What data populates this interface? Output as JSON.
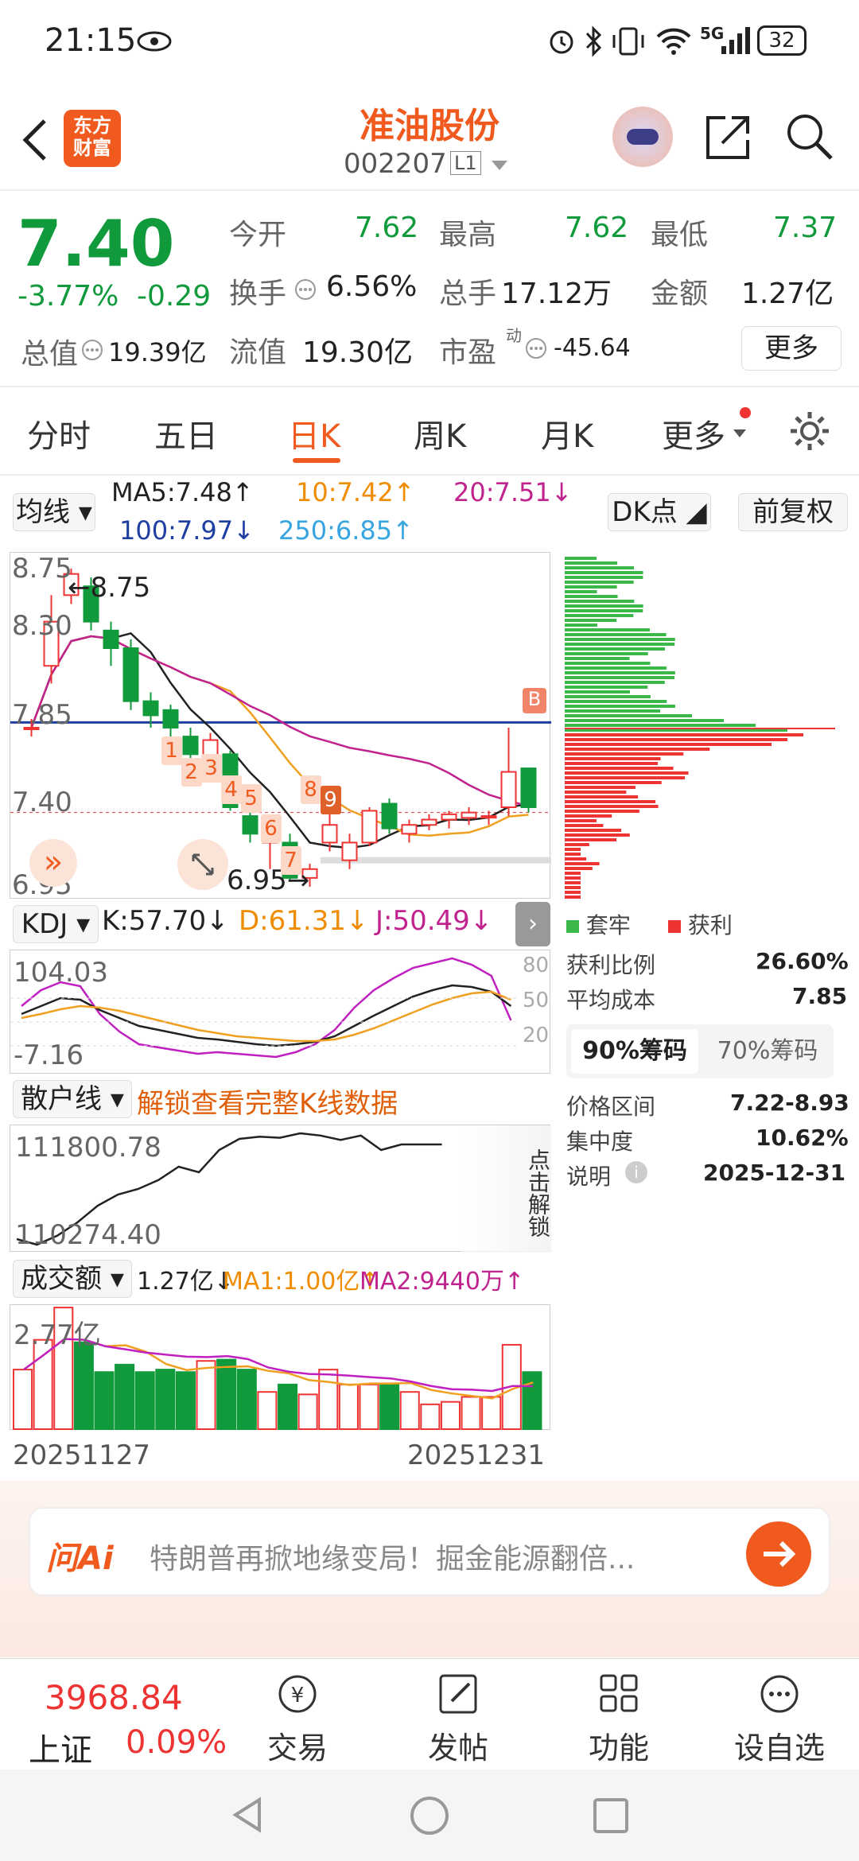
{
  "status": {
    "time": "21:15",
    "battery": "32",
    "network": "5G"
  },
  "header": {
    "name": "准油股份",
    "code": "002207",
    "badge": "L1",
    "logo": "东方\n财富",
    "logo_l1": "东方",
    "logo_l2": "财富"
  },
  "quote": {
    "price": "7.40",
    "pct": "-3.77%",
    "chg": "-0.29",
    "open_label": "今开",
    "open": "7.62",
    "high_label": "最高",
    "high": "7.62",
    "low_label": "最低",
    "low": "7.37",
    "turnover_label": "换手",
    "turnover": "6.56%",
    "vol_label": "总手",
    "vol": "17.12万",
    "amt_label": "金额",
    "amt": "1.27亿",
    "mcap_label": "总值",
    "mcap": "19.39亿",
    "float_label": "流值",
    "float": "19.30亿",
    "pe_label": "市盈",
    "pe_sup": "动",
    "pe": "-45.64",
    "more": "更多"
  },
  "tabs": [
    "分时",
    "五日",
    "日K",
    "周K",
    "月K",
    "更多"
  ],
  "ma": {
    "label": "均线",
    "ma5": "MA5:7.48↑",
    "ma10": "10:7.42↑",
    "ma20": "20:7.51↓",
    "ma100": "100:7.97↓",
    "ma250": "250:6.85↑",
    "dk": "DK点",
    "fq": "前复权"
  },
  "kline": {
    "y_labels": [
      "8.75",
      "8.30",
      "7.85",
      "7.40",
      "6.95"
    ],
    "high_marker": "8.75",
    "low_marker": "6.95",
    "b_marker": "B",
    "seq": [
      "1",
      "2",
      "3",
      "4",
      "5",
      "6",
      "7",
      "8",
      "9"
    ]
  },
  "chips": {
    "legend_trapped": "套牢",
    "legend_profit": "获利",
    "profit_ratio_label": "获利比例",
    "profit_ratio": "26.60%",
    "avg_cost_label": "平均成本",
    "avg_cost": "7.85",
    "tab90": "90%筹码",
    "tab70": "70%筹码",
    "range_label": "价格区间",
    "range": "7.22-8.93",
    "conc_label": "集中度",
    "conc": "10.62%",
    "note_label": "说明",
    "note_date": "2025-12-31"
  },
  "kdj": {
    "label": "KDJ",
    "k": "K:57.70↓",
    "d": "D:61.31↓",
    "j": "J:50.49↓",
    "top": "104.03",
    "bottom": "-7.16",
    "r80": "80",
    "r50": "50",
    "r20": "20"
  },
  "retail": {
    "label": "散户线",
    "unlock_text": "解锁查看完整K线数据",
    "top": "111800.78",
    "bottom": "110274.40",
    "unlock_btn": "点击解锁"
  },
  "volume": {
    "label": "成交额",
    "v": "1.27亿↓",
    "ma1": "MA1:1.00亿↑",
    "ma2": "MA2:9440万↑",
    "top": "2.77亿",
    "start_date": "20251127",
    "end_date": "20251231"
  },
  "ai": {
    "brand": "问Ai",
    "text": "特朗普再掀地缘变局！掘金能源翻倍..."
  },
  "index": {
    "value": "3968.84",
    "name": "上证",
    "pct": "0.09%"
  },
  "bottom_nav": [
    "交易",
    "发帖",
    "功能",
    "设自选"
  ],
  "colors": {
    "up": "#e33",
    "down": "#109a3b",
    "accent": "#f05a1e"
  },
  "chart_data": {
    "type": "candlestick",
    "dates_range": [
      "20251127",
      "20251231"
    ],
    "ylim": [
      6.95,
      8.75
    ],
    "candles": [
      {
        "o": 7.85,
        "c": 7.85,
        "h": 7.9,
        "l": 7.8
      },
      {
        "o": 8.2,
        "c": 8.45,
        "h": 8.6,
        "l": 8.1
      },
      {
        "o": 8.6,
        "c": 8.72,
        "h": 8.75,
        "l": 8.55
      },
      {
        "o": 8.65,
        "c": 8.45,
        "h": 8.7,
        "l": 8.4
      },
      {
        "o": 8.4,
        "c": 8.3,
        "h": 8.45,
        "l": 8.2
      },
      {
        "o": 8.3,
        "c": 8.0,
        "h": 8.35,
        "l": 7.95
      },
      {
        "o": 8.0,
        "c": 7.92,
        "h": 8.05,
        "l": 7.85
      },
      {
        "o": 7.95,
        "c": 7.85,
        "h": 7.98,
        "l": 7.8
      },
      {
        "o": 7.8,
        "c": 7.7,
        "h": 7.85,
        "l": 7.55
      },
      {
        "o": 7.68,
        "c": 7.78,
        "h": 7.82,
        "l": 7.6
      },
      {
        "o": 7.7,
        "c": 7.4,
        "h": 7.72,
        "l": 7.38
      },
      {
        "o": 7.35,
        "c": 7.25,
        "h": 7.45,
        "l": 7.2
      },
      {
        "o": 7.2,
        "c": 7.3,
        "h": 7.32,
        "l": 7.05
      },
      {
        "o": 7.2,
        "c": 7.0,
        "h": 7.25,
        "l": 6.98
      },
      {
        "o": 7.0,
        "c": 7.05,
        "h": 7.08,
        "l": 6.95
      },
      {
        "o": 7.2,
        "c": 7.3,
        "h": 7.45,
        "l": 7.15
      },
      {
        "o": 7.1,
        "c": 7.2,
        "h": 7.25,
        "l": 7.05
      },
      {
        "o": 7.2,
        "c": 7.38,
        "h": 7.4,
        "l": 7.18
      },
      {
        "o": 7.42,
        "c": 7.28,
        "h": 7.45,
        "l": 7.25
      },
      {
        "o": 7.25,
        "c": 7.3,
        "h": 7.33,
        "l": 7.2
      },
      {
        "o": 7.3,
        "c": 7.33,
        "h": 7.36,
        "l": 7.27
      },
      {
        "o": 7.33,
        "c": 7.36,
        "h": 7.38,
        "l": 7.28
      },
      {
        "o": 7.34,
        "c": 7.37,
        "h": 7.4,
        "l": 7.3
      },
      {
        "o": 7.35,
        "c": 7.35,
        "h": 7.38,
        "l": 7.3
      },
      {
        "o": 7.4,
        "c": 7.6,
        "h": 7.85,
        "l": 7.35
      },
      {
        "o": 7.62,
        "c": 7.4,
        "h": 7.62,
        "l": 7.37
      }
    ]
  }
}
